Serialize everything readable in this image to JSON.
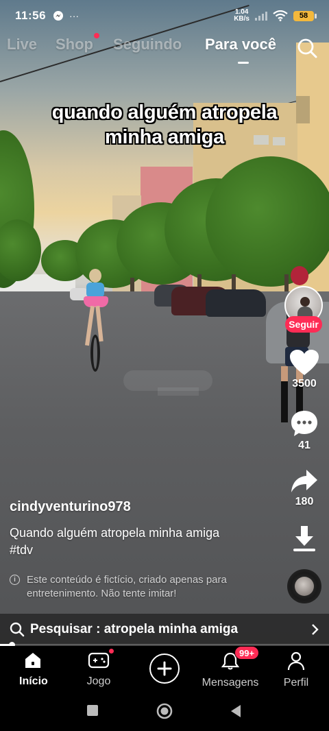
{
  "status_bar": {
    "time": "11:56",
    "left_icons": [
      "messenger-icon",
      "more-icon"
    ],
    "left_more_glyph": "···",
    "net_speed": "1.04",
    "net_unit": "KB/s",
    "battery": "58"
  },
  "top_tabs": {
    "items": [
      {
        "label": "Live"
      },
      {
        "label": "Shop"
      },
      {
        "label": "Seguindo"
      },
      {
        "label": "Para você"
      }
    ],
    "active": "Para você"
  },
  "video": {
    "overlay_line1": "quando alguém atropela",
    "overlay_line2": "minha amiga"
  },
  "actions": {
    "follow_label": "Seguir",
    "likes": "3500",
    "comments": "41",
    "shares": "180"
  },
  "post": {
    "username": "cindyventurino978",
    "description": "Quando alguém atropela minha amiga",
    "hashtag": "#tdv",
    "disclaimer": "Este conteúdo é fictício, criado apenas para entretenimento. Não tente imitar!"
  },
  "search_suggestion": {
    "text": "Pesquisar : atropela minha amiga"
  },
  "bottom_nav": {
    "items": [
      {
        "label": "Início",
        "icon": "home-icon"
      },
      {
        "label": "Jogo",
        "icon": "gamepad-icon"
      },
      {
        "label": "",
        "icon": "plus-icon"
      },
      {
        "label": "Mensagens",
        "icon": "bell-icon"
      },
      {
        "label": "Perfil",
        "icon": "profile-icon"
      }
    ],
    "active": "Início",
    "messages_badge": "99+"
  },
  "colors": {
    "accent": "#fe2c55",
    "battery": "#f3b83c"
  }
}
